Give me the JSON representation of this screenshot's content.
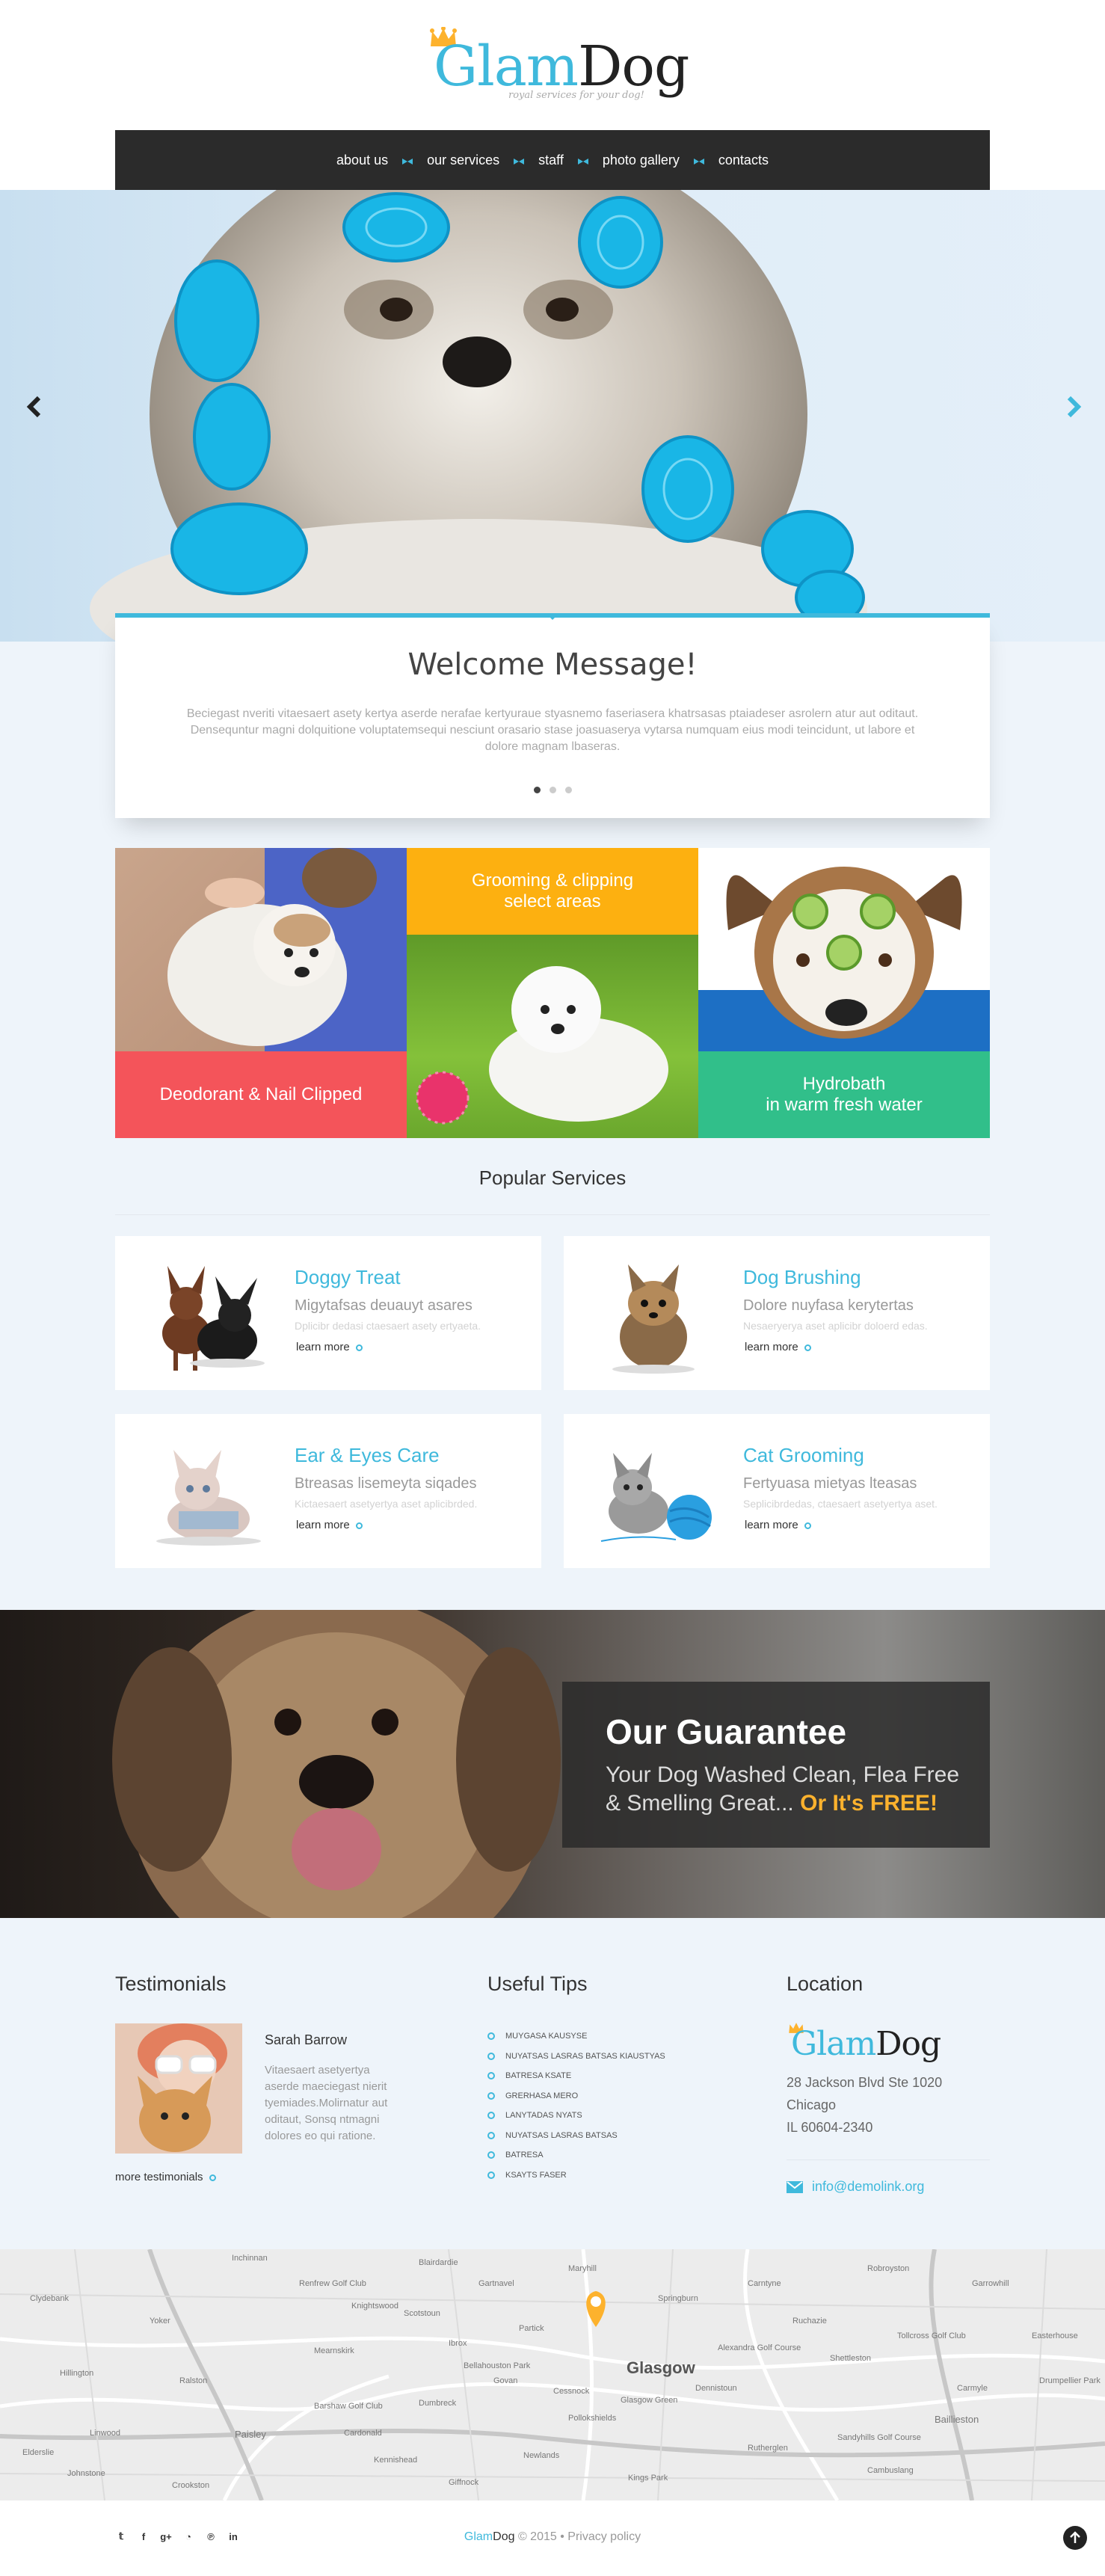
{
  "brand": {
    "glam": "Glam",
    "dog": "Dog",
    "tagline": "royal services for your dog!"
  },
  "nav": [
    "about us",
    "our services",
    "staff",
    "photo gallery",
    "contacts"
  ],
  "welcome": {
    "title": "Welcome Message!",
    "text": "Beciegast nveriti vitaesaert asety kertya aserde nerafae kertyuraue styasnemo faseriasera khatrsasas ptaiadeser asrolern atur aut oditaut. Densequntur magni dolquitione voluptatemsequi nesciunt orasario stase joasuaserya vytarsa numquam eius modi teincidunt, ut labore et dolore magnam lbaseras.",
    "slides": 3,
    "active_slide": 0
  },
  "tiles": [
    {
      "label": "Deodorant & Nail Clipped",
      "color": "#f4545a"
    },
    {
      "label": "Grooming & clipping\nselect areas",
      "color": "#fdb010"
    },
    {
      "label": "Hydrobath\nin warm fresh water",
      "color": "#31bf8a"
    }
  ],
  "services_title": "Popular Services",
  "services": [
    {
      "title": "Doggy Treat",
      "subtitle": "Migytafsas deuauyt asares",
      "desc": "Dplicibr dedasi ctaesaert asety ertyaeta.",
      "more": "learn more",
      "icon": "chihuahua-image"
    },
    {
      "title": "Dog Brushing",
      "subtitle": "Dolore nuyfasa kerytertas",
      "desc": "Nesaeryerya aset aplicibr doloerd edas.",
      "more": "learn more",
      "icon": "yorkshire-image"
    },
    {
      "title": "Ear & Eyes Care",
      "subtitle": "Btreasas lisemeyta siqades",
      "desc": "Kictaesaert asetyertya aset aplicibrded.",
      "more": "learn more",
      "icon": "sphynx-cat-image"
    },
    {
      "title": "Cat Grooming",
      "subtitle": "Fertyuasa mietyas lteasas",
      "desc": "Seplicibrdedas, ctaesaert asetyertya aset.",
      "more": "learn more",
      "icon": "kitten-yarn-image"
    }
  ],
  "guarantee": {
    "title": "Our Guarantee",
    "text": "Your Dog Washed Clean, Flea Free & Smelling Great... ",
    "accent": "Or It's FREE!",
    "accent_color": "#fdb22d"
  },
  "testimonials": {
    "title": "Testimonials",
    "name": "Sarah Barrow",
    "text": "Vitaesaert asetyertya aserde maeciegast nierit tyemiades.Molirnatur aut oditaut, Sonsq ntmagni dolores eo qui ratione.",
    "more": "more testimonials"
  },
  "tips": {
    "title": "Useful Tips",
    "items": [
      "MUYGASA KAUSYSE",
      "NUYATSAS LASRAS BATSAS KIAUSTYAS",
      "BATRESA KSATE",
      "GRERHASA MERO",
      "LANYTADAS NYATS",
      "NUYATSAS LASRAS BATSAS",
      "BATRESA",
      "KSAYTS FASER"
    ]
  },
  "location": {
    "title": "Location",
    "address": [
      "28 Jackson Blvd Ste 1020",
      "Chicago",
      "IL 60604-2340"
    ],
    "email": "info@demolink.org"
  },
  "map": {
    "city": "Glasgow",
    "labels": [
      "Inchinnan",
      "Renfrew Golf Club",
      "Mearnskirk",
      "Partick",
      "Scotstoun",
      "Govan",
      "Cessnock",
      "Dennistoun",
      "Shettleston",
      "Bellahouston Park",
      "Pollokshields",
      "Dumbreck",
      "Tollcross Golf Club",
      "Carmyle",
      "Paisley",
      "Barshaw Golf Club",
      "Elderslie",
      "Johnstone",
      "Linwood",
      "Ibrox",
      "Glasgow Green",
      "Alexandra Golf Course",
      "Ruchazie",
      "Garrowhill",
      "Baillieston",
      "Newlands",
      "Kings Park",
      "Rutherglen",
      "Cambuslang",
      "Giffnock",
      "Kennishead",
      "Ralston",
      "Crookston",
      "Easterhouse",
      "Carntyne",
      "Sandyhills Golf Course",
      "Drumpellier Park",
      "Blairdardie",
      "Knightswood",
      "Yoker",
      "Clydebank",
      "Cardonald",
      "Hillington",
      "Gartnavel",
      "Maryhill",
      "Springburn",
      "Robroyston"
    ]
  },
  "footer": {
    "brand_glam": "Glam",
    "brand_dog": "Dog",
    "copyright": " © 2015 • ",
    "privacy": "Privacy policy",
    "social": [
      "twitter-icon",
      "facebook-icon",
      "google-plus-icon",
      "rss-icon",
      "pinterest-icon",
      "linkedin-icon"
    ]
  }
}
